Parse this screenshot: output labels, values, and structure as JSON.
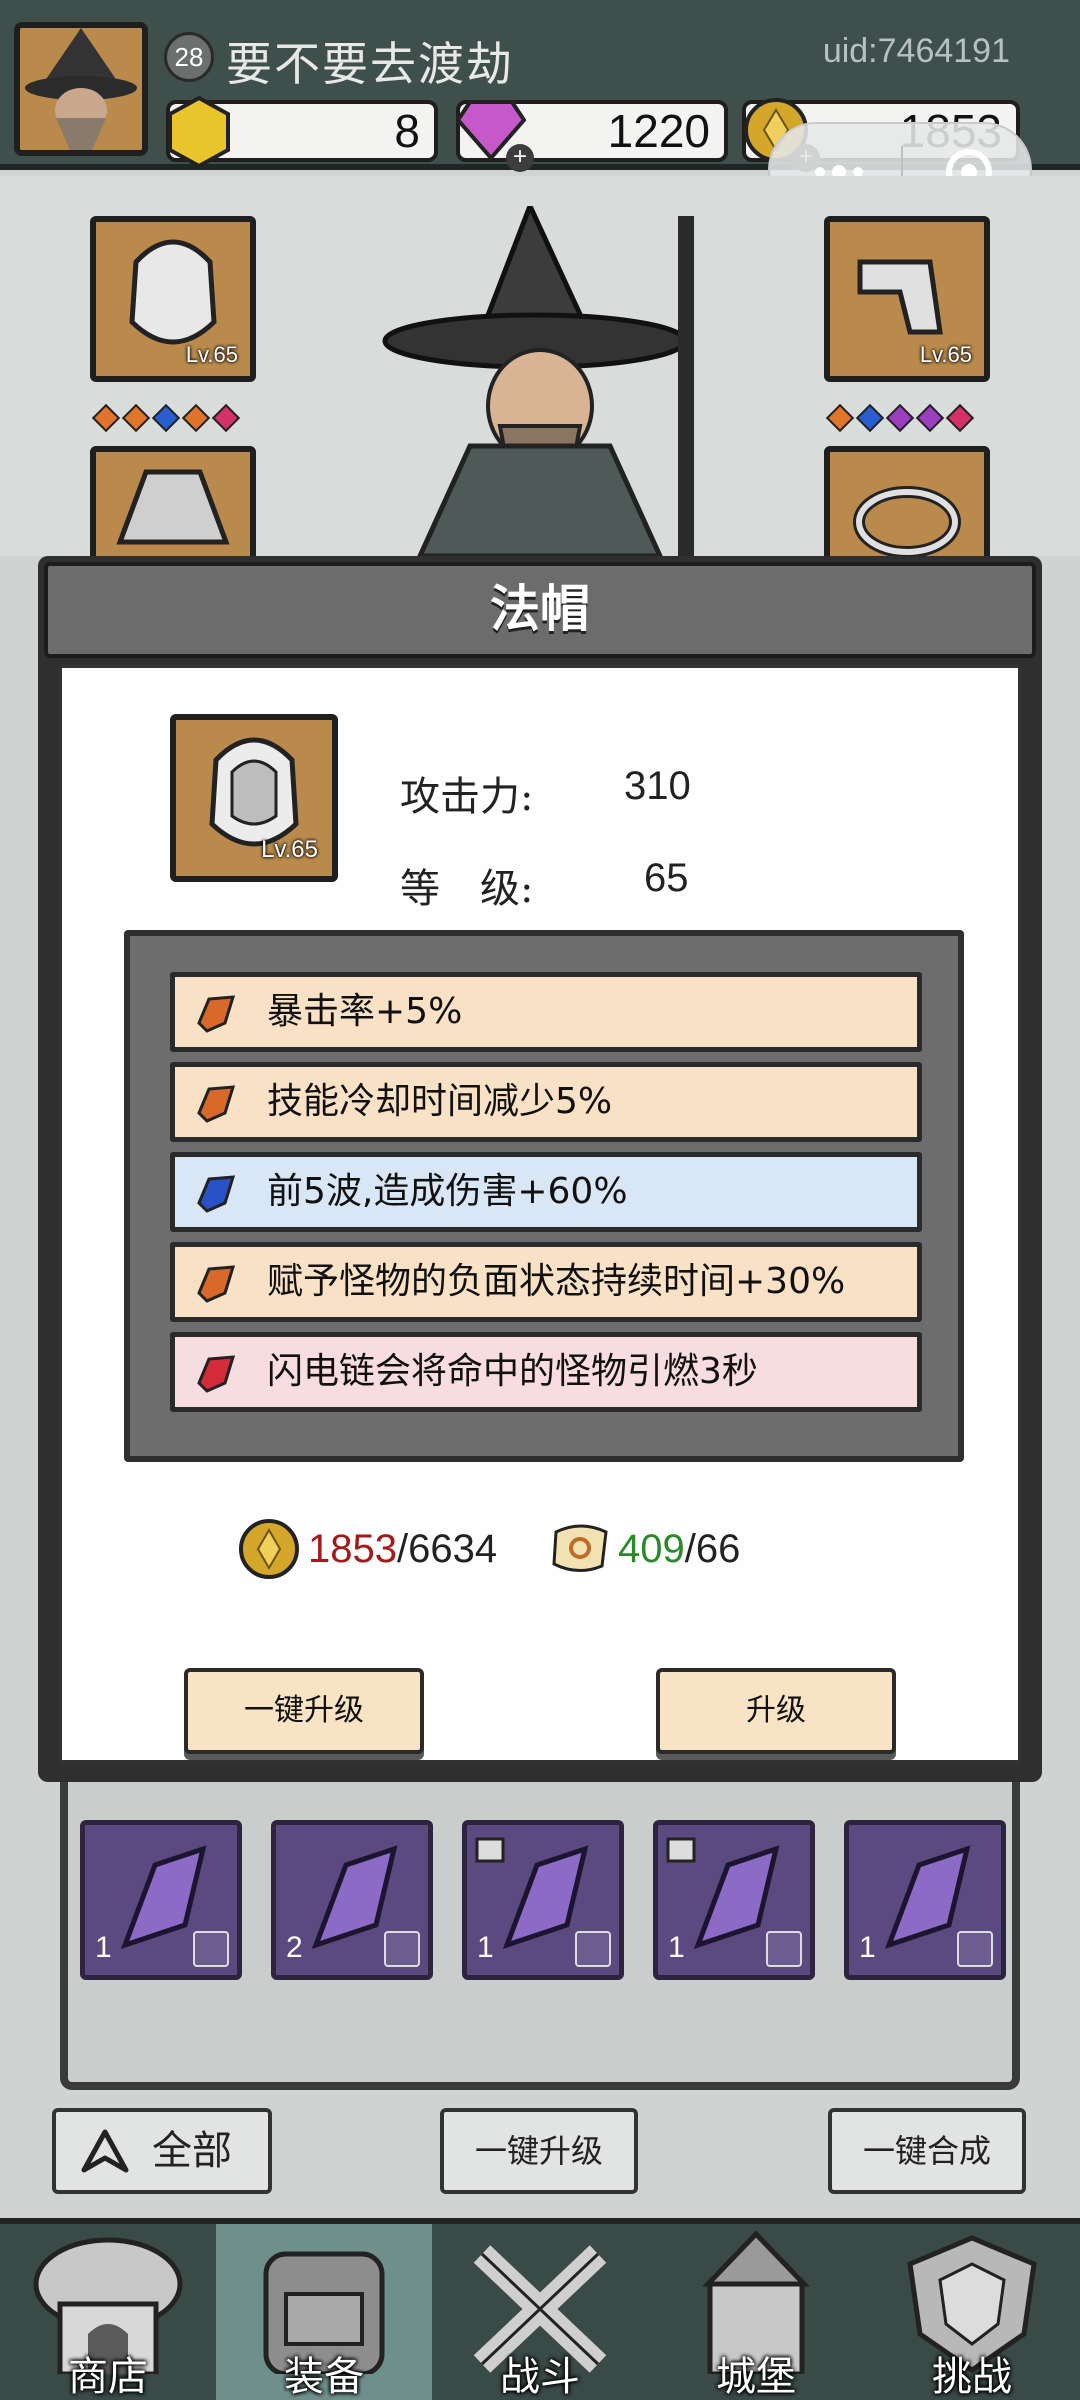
{
  "player": {
    "level": "28",
    "name": "要不要去渡劫",
    "uid": "uid:7464191"
  },
  "resources": {
    "gem": "8",
    "diamond": "1220",
    "coin": "1853"
  },
  "equipment": {
    "slot_top_left_level": "Lv.65",
    "slot_top_right_level": "Lv.65"
  },
  "modal": {
    "title": "法帽",
    "item_level_badge": "Lv.65",
    "attack_label": "攻击力:",
    "attack_value": "310",
    "level_label": "等　级:",
    "level_value": "65",
    "attributes": [
      {
        "text": "暴击率+5%",
        "gem": "orange"
      },
      {
        "text": "技能冷却时间减少5%",
        "gem": "orange"
      },
      {
        "text": "前5波,造成伤害+60%",
        "gem": "blue"
      },
      {
        "text": "赋予怪物的负面状态持续时间+30%",
        "gem": "orange"
      },
      {
        "text": "闪电链会将命中的怪物引燃3秒",
        "gem": "red"
      }
    ],
    "cost_coin_have": "1853",
    "cost_coin_need": "/6634",
    "cost_scroll_have": "409",
    "cost_scroll_need": "/66",
    "btn_upgrade_all": "一键升级",
    "btn_upgrade": "升级"
  },
  "bag": {
    "items": [
      {
        "count": "1"
      },
      {
        "count": "2"
      },
      {
        "count": "1"
      },
      {
        "count": "1"
      },
      {
        "count": "1"
      }
    ]
  },
  "bottom_buttons": {
    "all": "全部",
    "upgrade_all": "一键升级",
    "merge_all": "一键合成"
  },
  "nav": {
    "shop": "商店",
    "equip": "装备",
    "battle": "战斗",
    "castle": "城堡",
    "challenge": "挑战"
  },
  "colors": {
    "attr_orange": "#f9e1c6",
    "attr_blue": "#d8e6f6",
    "attr_red": "#f8dde0",
    "accent_red": "#a31a1a",
    "accent_green": "#2a8a2a"
  }
}
